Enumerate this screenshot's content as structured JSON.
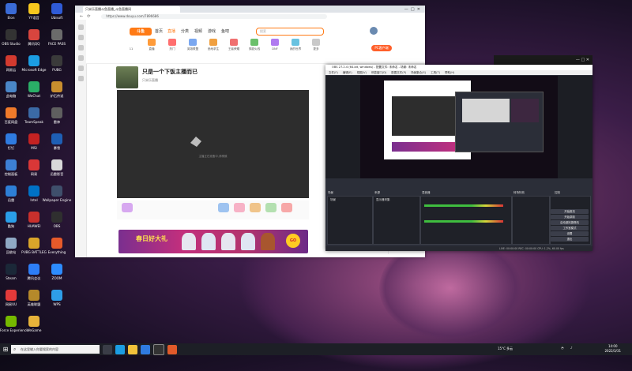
{
  "desktop": {
    "icons": [
      {
        "label": "Elon",
        "color": "#3a6bd6"
      },
      {
        "label": "OBS Studio",
        "color": "#333333"
      },
      {
        "label": "网易云",
        "color": "#d33a2f"
      },
      {
        "label": "此电脑",
        "color": "#4a86c7"
      },
      {
        "label": "百度网盘",
        "color": "#f07a2a"
      },
      {
        "label": "钉钉",
        "color": "#2f7be0"
      },
      {
        "label": "控制面板",
        "color": "#3d7fd4"
      },
      {
        "label": "迅雷",
        "color": "#2e7fd6"
      },
      {
        "label": "酷狗",
        "color": "#2a9ee8"
      },
      {
        "label": "回收站",
        "color": "#8fa9c4"
      },
      {
        "label": "Steam",
        "color": "#1b2838"
      },
      {
        "label": "网易UU",
        "color": "#e23a3a"
      },
      {
        "label": "GeForce Experience",
        "color": "#76b900"
      },
      {
        "label": "YY语音",
        "color": "#f7c81e"
      },
      {
        "label": "腾讯QQ",
        "color": "#d8453e"
      },
      {
        "label": "Microsoft Edge",
        "color": "#1b9de2"
      },
      {
        "label": "WeChat",
        "color": "#2aae67"
      },
      {
        "label": "TeamSpeak",
        "color": "#3b6aa6"
      },
      {
        "label": "MSI",
        "color": "#c42222"
      },
      {
        "label": "网易",
        "color": "#d93737"
      },
      {
        "label": "Intel",
        "color": "#0071c5"
      },
      {
        "label": "HUAWEI",
        "color": "#c9302c"
      },
      {
        "label": "PUBG BATTLEG",
        "color": "#d9a52a"
      },
      {
        "label": "腾讯会议",
        "color": "#2d7ef7"
      },
      {
        "label": "英雄联盟",
        "color": "#b5892a"
      },
      {
        "label": "WeGame",
        "color": "#e6b23a"
      },
      {
        "label": "Ubisoft",
        "color": "#2f5bd6"
      },
      {
        "label": "FACE PASS",
        "color": "#6b6b6b"
      },
      {
        "label": "PUBG",
        "color": "#3a3a3a"
      },
      {
        "label": "炉石传说",
        "color": "#c98e2e"
      },
      {
        "label": "雷神",
        "color": "#5f5f5f"
      },
      {
        "label": "暴雪",
        "color": "#1e5fb5"
      },
      {
        "label": "迅雷影音",
        "color": "#d9d9d9"
      },
      {
        "label": "Wallpaper Engine",
        "color": "#3f4f6b"
      },
      {
        "label": "OBS",
        "color": "#2f2f2f"
      },
      {
        "label": "Everything",
        "color": "#e65a2a"
      },
      {
        "label": "ZOOM",
        "color": "#2d8cff"
      },
      {
        "label": "WPS",
        "color": "#2e9ee8"
      }
    ]
  },
  "browser": {
    "tab_title": "只米乐直播斗鱼直播_斗鱼直播间",
    "url": "https://www.douyu.com/7896686",
    "nav": [
      "首页",
      "直播",
      "分类",
      "视频",
      "游戏",
      "鱼吧"
    ],
    "search_placeholder": "搜索",
    "pc_button": "PC客户端",
    "categories": [
      "11",
      "直播",
      "热门",
      "英雄联盟",
      "绝地求生",
      "王者荣耀",
      "穿越火线",
      "DNF",
      "我的世界",
      "更多"
    ],
    "room_title": "只是一个下饭主播而已",
    "host_name": "只米乐直播",
    "follow_label": "关注",
    "player_caption": "主播正在准备中,请稍候",
    "banner_text": "春日好大礼",
    "banner_go": "GO"
  },
  "obs": {
    "title": "OBS 27.2.4 (64-bit, windows) - 配置文件: 未命名 - 场景: 未命名",
    "menu": [
      "文件(F)",
      "编辑(E)",
      "视图(V)",
      "停靠窗口(D)",
      "配置文件(P)",
      "场景集合(S)",
      "工具(T)",
      "帮助(H)"
    ],
    "docks": [
      "场景",
      "来源",
      "混音器",
      "转场特效",
      "控制"
    ],
    "scene_item": "场景",
    "source_item": "显示器采集",
    "controls": [
      "开始推流",
      "开始录制",
      "启动虚拟摄像机",
      "工作室模式",
      "设置",
      "退出"
    ],
    "status": "LIVE: 00:00:00   REC: 00:00:00   CPU: 1.2%, 60.00 fps"
  },
  "taskbar": {
    "search_placeholder": "在这里输入你要搜索的内容",
    "weather": "15°C 多云",
    "time": "14:00",
    "date": "2022/3/31"
  }
}
